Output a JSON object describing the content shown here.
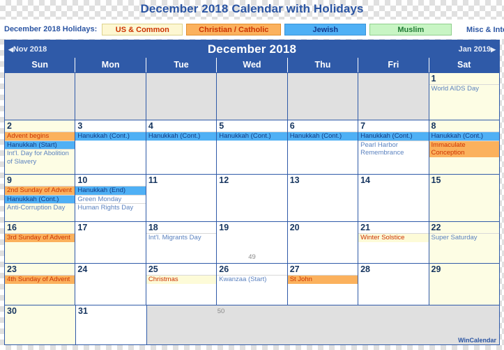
{
  "page_title": "December 2018 Calendar with Holidays",
  "legend": {
    "label": "December 2018 Holidays:",
    "chips": [
      {
        "id": "us-common",
        "label": "US & Common",
        "bg": "#fdf7d2",
        "fg": "#cc3300"
      },
      {
        "id": "christian-catholic",
        "label": "Christian / Catholic",
        "bg": "#fbb15d",
        "fg": "#cc3300"
      },
      {
        "id": "jewish",
        "label": "Jewish",
        "bg": "#4fb0f5",
        "fg": "#143a8c"
      },
      {
        "id": "muslim",
        "label": "Muslim",
        "bg": "#c8f5c4",
        "fg": "#1f7a33"
      },
      {
        "id": "misc-international",
        "label": "Misc & International",
        "bg": "#ffffff",
        "fg": "#2b55a3"
      }
    ]
  },
  "calendar": {
    "prev_month": "Nov 2018",
    "month_title": "December 2018",
    "next_month": "Jan 2019",
    "weekdays": [
      "Sun",
      "Mon",
      "Tue",
      "Wed",
      "Thu",
      "Fri",
      "Sat"
    ],
    "weeks": [
      {
        "week_number": "",
        "days": [
          {
            "num": "",
            "blank": true,
            "weekend": false,
            "events": []
          },
          {
            "num": "",
            "blank": true,
            "weekend": false,
            "events": []
          },
          {
            "num": "",
            "blank": true,
            "weekend": false,
            "events": []
          },
          {
            "num": "",
            "blank": true,
            "weekend": false,
            "events": []
          },
          {
            "num": "",
            "blank": true,
            "weekend": false,
            "events": []
          },
          {
            "num": "",
            "blank": true,
            "weekend": false,
            "events": []
          },
          {
            "num": "1",
            "blank": false,
            "weekend": true,
            "events": [
              {
                "text": "World AIDS Day",
                "cat": "misc"
              }
            ]
          }
        ]
      },
      {
        "week_number": "",
        "days": [
          {
            "num": "2",
            "blank": false,
            "weekend": true,
            "events": [
              {
                "text": "Advent begins",
                "cat": "chr"
              },
              {
                "text": "Hanukkah (Start)",
                "cat": "jew"
              },
              {
                "text": "Int'l. Day for Abolition of Slavery",
                "cat": "misc"
              }
            ]
          },
          {
            "num": "3",
            "blank": false,
            "weekend": false,
            "events": [
              {
                "text": "Hanukkah (Cont.)",
                "cat": "jew"
              }
            ]
          },
          {
            "num": "4",
            "blank": false,
            "weekend": false,
            "events": [
              {
                "text": "Hanukkah (Cont.)",
                "cat": "jew"
              }
            ]
          },
          {
            "num": "5",
            "blank": false,
            "weekend": false,
            "events": [
              {
                "text": "Hanukkah (Cont.)",
                "cat": "jew"
              }
            ]
          },
          {
            "num": "6",
            "blank": false,
            "weekend": false,
            "events": [
              {
                "text": "Hanukkah (Cont.)",
                "cat": "jew"
              }
            ]
          },
          {
            "num": "7",
            "blank": false,
            "weekend": false,
            "events": [
              {
                "text": "Hanukkah (Cont.)",
                "cat": "jew"
              },
              {
                "text": "Pearl Harbor Remembrance",
                "cat": "misc"
              }
            ]
          },
          {
            "num": "8",
            "blank": false,
            "weekend": true,
            "events": [
              {
                "text": "Hanukkah (Cont.)",
                "cat": "jew"
              },
              {
                "text": "Immaculate Conception",
                "cat": "chr"
              }
            ]
          }
        ]
      },
      {
        "week_number": "",
        "days": [
          {
            "num": "9",
            "blank": false,
            "weekend": true,
            "events": [
              {
                "text": "2nd Sunday of Advent",
                "cat": "chr"
              },
              {
                "text": "Hanukkah (Cont.)",
                "cat": "jew"
              },
              {
                "text": "Anti-Corruption Day",
                "cat": "misc"
              }
            ]
          },
          {
            "num": "10",
            "blank": false,
            "weekend": false,
            "events": [
              {
                "text": "Hanukkah (End)",
                "cat": "jew"
              },
              {
                "text": "Green Monday",
                "cat": "misc"
              },
              {
                "text": "Human Rights Day",
                "cat": "misc"
              }
            ]
          },
          {
            "num": "11",
            "blank": false,
            "weekend": false,
            "events": []
          },
          {
            "num": "12",
            "blank": false,
            "weekend": false,
            "events": []
          },
          {
            "num": "13",
            "blank": false,
            "weekend": false,
            "events": []
          },
          {
            "num": "14",
            "blank": false,
            "weekend": false,
            "events": []
          },
          {
            "num": "15",
            "blank": false,
            "weekend": true,
            "events": []
          }
        ]
      },
      {
        "week_number": "49",
        "days": [
          {
            "num": "16",
            "blank": false,
            "weekend": true,
            "events": [
              {
                "text": "3rd Sunday of Advent",
                "cat": "chr"
              }
            ]
          },
          {
            "num": "17",
            "blank": false,
            "weekend": false,
            "events": []
          },
          {
            "num": "18",
            "blank": false,
            "weekend": false,
            "events": [
              {
                "text": "Int'l. Migrants Day",
                "cat": "misc"
              }
            ]
          },
          {
            "num": "19",
            "blank": false,
            "weekend": false,
            "events": []
          },
          {
            "num": "20",
            "blank": false,
            "weekend": false,
            "events": []
          },
          {
            "num": "21",
            "blank": false,
            "weekend": false,
            "events": [
              {
                "text": "Winter Solstice",
                "cat": "us"
              }
            ]
          },
          {
            "num": "22",
            "blank": false,
            "weekend": true,
            "events": [
              {
                "text": "Super Saturday",
                "cat": "misc"
              }
            ]
          }
        ]
      },
      {
        "week_number": "",
        "days": [
          {
            "num": "23",
            "blank": false,
            "weekend": true,
            "events": [
              {
                "text": "4th Sunday of Advent",
                "cat": "chr"
              }
            ]
          },
          {
            "num": "24",
            "blank": false,
            "weekend": false,
            "events": []
          },
          {
            "num": "25",
            "blank": false,
            "weekend": false,
            "events": [
              {
                "text": "Christmas",
                "cat": "us"
              }
            ]
          },
          {
            "num": "26",
            "blank": false,
            "weekend": false,
            "events": [
              {
                "text": "Kwanzaa (Start)",
                "cat": "misc"
              }
            ]
          },
          {
            "num": "27",
            "blank": false,
            "weekend": false,
            "events": [
              {
                "text": "St John",
                "cat": "chr"
              }
            ]
          },
          {
            "num": "28",
            "blank": false,
            "weekend": false,
            "events": []
          },
          {
            "num": "29",
            "blank": false,
            "weekend": true,
            "events": []
          }
        ]
      },
      {
        "week_number": "50",
        "days": [
          {
            "num": "30",
            "blank": false,
            "weekend": true,
            "events": []
          },
          {
            "num": "31",
            "blank": false,
            "weekend": false,
            "events": []
          }
        ]
      }
    ],
    "brand": "WinCalendar"
  }
}
